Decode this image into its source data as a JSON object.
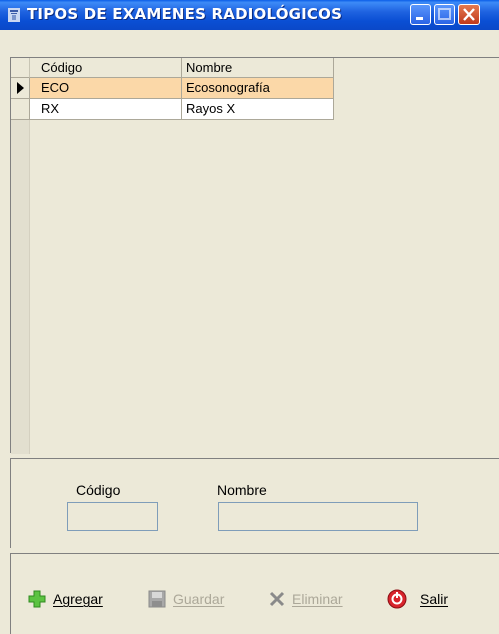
{
  "window": {
    "title": "TIPOS DE EXAMENES RADIOLÓGICOS"
  },
  "grid": {
    "columns": [
      "Código",
      "Nombre"
    ],
    "rows": [
      {
        "codigo": "ECO",
        "nombre": "Ecosonografía",
        "selected": true
      },
      {
        "codigo": "RX",
        "nombre": "Rayos X",
        "selected": false
      }
    ]
  },
  "form": {
    "codigo_label": "Código",
    "nombre_label": "Nombre",
    "codigo_value": "",
    "nombre_value": ""
  },
  "toolbar": {
    "agregar_label": "Agregar",
    "guardar_label": "Guardar",
    "eliminar_label": "Eliminar",
    "salir_label": "Salir"
  },
  "colors": {
    "titlebar": "#0a4fd4",
    "selected_row": "#fbd8a8",
    "disabled_text": "#aca899"
  }
}
